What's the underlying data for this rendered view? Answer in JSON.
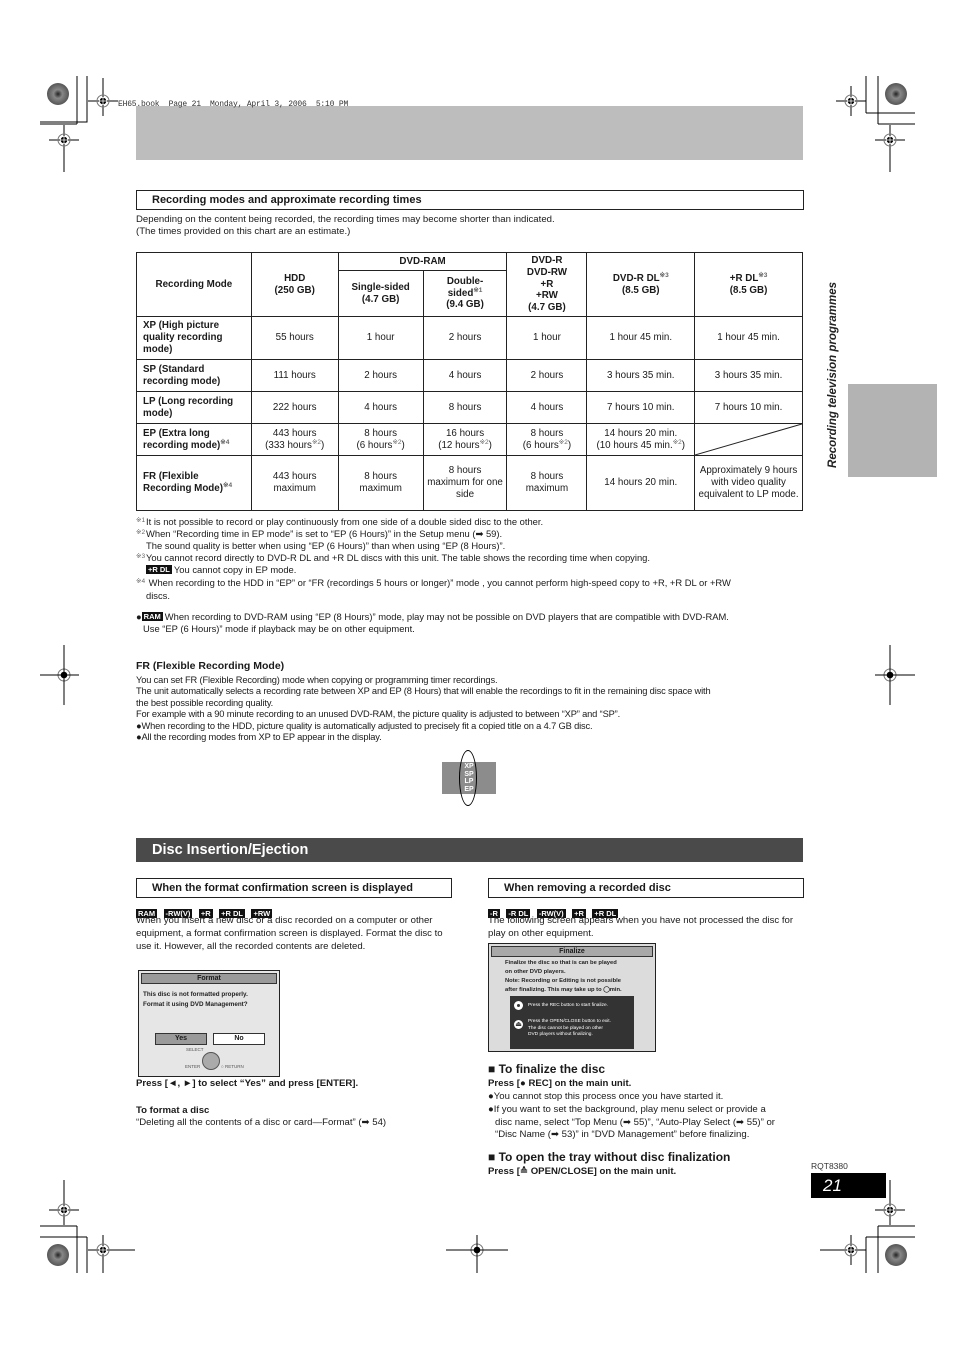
{
  "print_header": "EH65.book  Page 21  Monday, April 3, 2006  5:10 PM",
  "side_label": "Recording television programmes",
  "recording_section": {
    "heading": "Recording modes and approximate recording times",
    "intro_line1": "Depending on the content being recorded, the recording times may become shorter than indicated.",
    "intro_line2": "(The times provided on this chart are an estimate.)",
    "table": {
      "headers": {
        "mode": "Recording Mode",
        "hdd": "HDD",
        "hdd_cap": "(250 GB)",
        "dvdram": "DVD-RAM",
        "single": "Single-sided",
        "single_cap": "(4.7 GB)",
        "double1": "Double-",
        "double2": "sided",
        "double_note": "※1",
        "double_cap": "(9.4 GB)",
        "dvdr1": "DVD-R",
        "dvdr2": "DVD-RW",
        "dvdr3": "+R",
        "dvdr4": "+RW",
        "dvdr_cap": "(4.7 GB)",
        "dvdrdl": "DVD-R DL",
        "dvdrdl_note": "※3",
        "dvdrdl_cap": "(8.5 GB)",
        "rdl": "+R DL",
        "rdl_note": "※3",
        "rdl_cap": "(8.5 GB)"
      },
      "rows": [
        {
          "mode": "XP (High picture quality recording mode)",
          "note": "",
          "hdd": "55 hours",
          "single": "1 hour",
          "double": "2 hours",
          "dvdr": "1 hour",
          "dvdrdl": "1 hour 45 min.",
          "rdl": "1 hour 45 min."
        },
        {
          "mode": "SP (Standard recording mode)",
          "note": "",
          "hdd": "111 hours",
          "single": "2 hours",
          "double": "4 hours",
          "dvdr": "2 hours",
          "dvdrdl": "3 hours 35 min.",
          "rdl": "3 hours 35 min."
        },
        {
          "mode": "LP (Long recording mode)",
          "note": "",
          "hdd": "222 hours",
          "single": "4 hours",
          "double": "8 hours",
          "dvdr": "4 hours",
          "dvdrdl": "7 hours 10 min.",
          "rdl": "7 hours 10 min."
        },
        {
          "mode": "EP (Extra long recording mode)",
          "note": "※4",
          "hdd": "443 hours",
          "hdd2": "(333 hours",
          "single": "8 hours",
          "single2": "(6 hours",
          "double": "16 hours",
          "double2": "(12 hours",
          "dvdr": "8 hours",
          "dvdr2": "(6 hours",
          "dvdrdl": "14 hours 20 min.",
          "dvdrdl2": "(10 hours 45 min.",
          "sub_note": "※2",
          "rdl": ""
        },
        {
          "mode": "FR (Flexible Recording Mode)",
          "note": "※4",
          "hdd": "443 hours maximum",
          "single": "8 hours maximum",
          "double": "8 hours maximum for one side",
          "dvdr": "8 hours maximum",
          "dvdrdl": "14 hours 20 min.",
          "rdl": "Approximately 9 hours with video quality equivalent to LP mode."
        }
      ]
    },
    "footnotes": [
      {
        "mark": "※1",
        "text": "It is not possible to record or play continuously from one side of a double sided disc to the other."
      },
      {
        "mark": "※2",
        "text": "When “Recording time in EP mode” is set to “EP (6 Hours)” in the Setup menu (➡ 59).",
        "text2": "The sound quality is better when using “EP (6 Hours)” than when using “EP (8 Hours)”."
      },
      {
        "mark": "※3",
        "text": "You cannot record directly to DVD-R DL and +R DL discs with this unit. The table shows the recording time when copying.",
        "badge": "+R DL",
        "text2": "You cannot copy in EP mode."
      },
      {
        "mark": "※4",
        "text": " When recording to the HDD in “EP” or “FR (recordings 5 hours or longer)” mode , you cannot perform high-speed copy to +R, +R DL or +RW",
        "text2": "discs."
      }
    ],
    "ram_note": {
      "badge": "RAM",
      "text": "When recording to DVD-RAM using “EP (8 Hours)” mode, play may not be possible on DVD players that are compatible with DVD-RAM.",
      "text2": "Use “EP (6 Hours)” mode if playback may be on other equipment."
    }
  },
  "fr_section": {
    "heading": "FR (Flexible Recording Mode)",
    "lines": [
      "You can set FR (Flexible Recording) mode when copying or programming timer recordings.",
      "The unit automatically selects a recording rate between XP and EP (8 Hours) that will enable the recordings to fit in the remaining disc space with",
      "the best possible recording quality.",
      "For example with a 90 minute recording to an unused DVD-RAM, the picture quality is adjusted to between “XP” and “SP”.",
      "●When recording to the HDD, picture quality is automatically adjusted to precisely fit a copied title on a 4.7 GB disc.",
      "●All the recording modes from XP to EP appear in the display."
    ],
    "display_modes": [
      "XP",
      "SP",
      "LP",
      "EP"
    ]
  },
  "disc_section": {
    "title": "Disc Insertion/Ejection",
    "format": {
      "heading": "When the format confirmation screen is displayed",
      "badges": [
        "RAM",
        "-RW(V)",
        "+R",
        "+R DL",
        "+RW"
      ],
      "body": "When you insert a new disc or a disc recorded on a computer or other equipment, a format confirmation screen is displayed. Format the disc to use it. However, all the recorded contents are deleted.",
      "screen": {
        "title": "Format",
        "msg1": "This disc is not formatted properly.",
        "msg2": "Format it using DVD Management?",
        "yes": "Yes",
        "no": "No",
        "select": "SELECT",
        "enter": "ENTER",
        "return": "RETURN"
      },
      "instruction": "Press [◄, ►] to select “Yes” and press [ENTER].",
      "sub_heading": "To format a disc",
      "sub_text": "“Deleting all the contents of a disc or card—Format” (➡ 54)"
    },
    "remove": {
      "heading": "When removing a recorded disc",
      "badges": [
        "-R",
        "-R DL",
        "-RW(V)",
        "+R",
        "+R DL"
      ],
      "body": "The following screen appears when you have not processed the disc for play on other equipment.",
      "screen": {
        "title": "Finalize",
        "l1": "Finalize the disc so that is can be played",
        "l2": "on other DVD players.",
        "l3": "Note: Recording or Editing is not possible",
        "l4": "after finalizing. This may take up to",
        "l4b": "min.",
        "opt1": "Press the REC button to start finalize.",
        "opt2a": "Press the OPEN/CLOSE button to exit.",
        "opt2b": "The disc cannot be played on other",
        "opt2c": "DVD players without finalizing."
      },
      "finalize_heading": "To finalize the disc",
      "finalize_press": "Press [● REC] on the main unit.",
      "finalize_b1": "●You cannot stop this process once you have started it.",
      "finalize_b2a": "●If you want to set the background, play menu select or provide a",
      "finalize_b2b": "disc name, select “Top Menu (➡ 55)”, “Auto-Play Select (➡ 55)” or",
      "finalize_b2c": "“Disc Name (➡ 53)” in “DVD Management” before finalizing.",
      "open_heading": "To open the tray without disc finalization",
      "open_press": "Press [≙ OPEN/CLOSE] on the main unit."
    }
  },
  "footer": {
    "doc_code": "RQT8380",
    "page_number": "21"
  }
}
